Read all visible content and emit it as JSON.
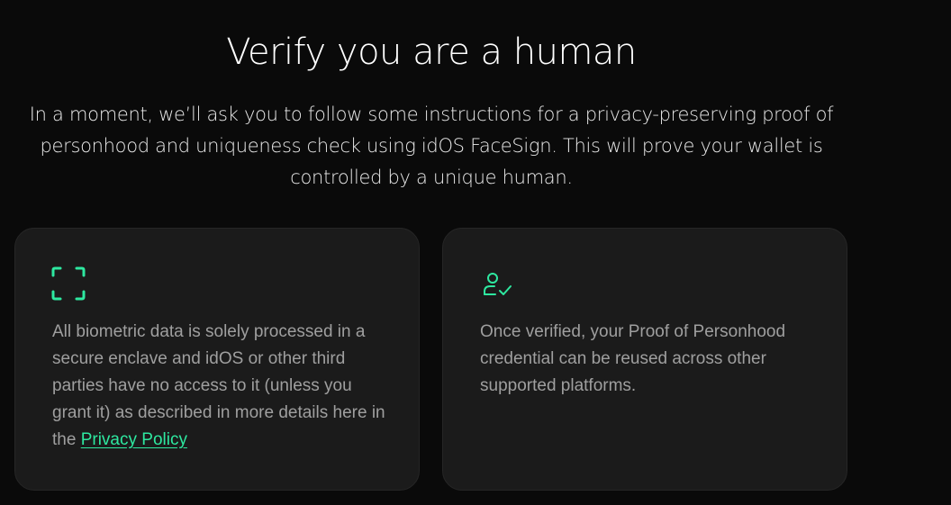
{
  "header": {
    "title": "Verify you are a human",
    "subtitle": "In a moment, we’ll ask you to follow some instructions for a privacy-preserving proof of personhood and uniqueness check using idOS FaceSign. This will prove your wallet is controlled by a unique human."
  },
  "cards": [
    {
      "icon": "face-scan-icon",
      "text": "All biometric data is solely processed in a secure enclave and idOS or other third parties have no access to it (unless you grant it) as described in more details here in the ",
      "link_label": "Privacy Policy"
    },
    {
      "icon": "user-check-icon",
      "text": "Once verified, your Proof of Personhood credential can be reused across other supported platforms."
    }
  ],
  "colors": {
    "background": "#0a0a0a",
    "card_background": "#1b1b1b",
    "accent": "#2ee8a0",
    "body_text": "#9f9f9f"
  }
}
